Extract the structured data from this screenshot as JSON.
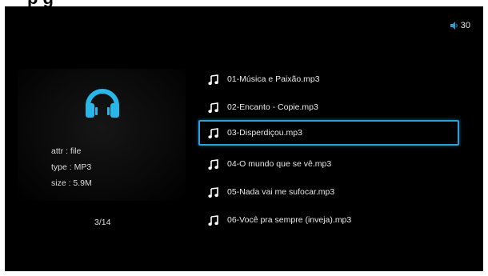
{
  "header": {
    "partial_title": "p g"
  },
  "status": {
    "volume": "30",
    "volume_icon": "speaker-icon"
  },
  "sidebar": {
    "icon": "headphones-icon",
    "accent_color": "#29b6e8",
    "attr": "attr : file",
    "type": "type : MP3",
    "size": "size : 5.9M",
    "page": "3/14"
  },
  "files": [
    {
      "name": "01-Música e Paixão.mp3",
      "selected": false
    },
    {
      "name": "02-Encanto - Copie.mp3",
      "selected": false
    },
    {
      "name": "03-Disperdiçou.mp3",
      "selected": true
    },
    {
      "name": "04-O mundo que se vê.mp3",
      "selected": false
    },
    {
      "name": "05-Nada vai me sufocar.mp3",
      "selected": false
    },
    {
      "name": "06-Você pra sempre (inveja).mp3",
      "selected": false
    }
  ],
  "colors": {
    "background": "#000000",
    "text": "#e8e8e8",
    "selection": "#2a9fd8"
  }
}
